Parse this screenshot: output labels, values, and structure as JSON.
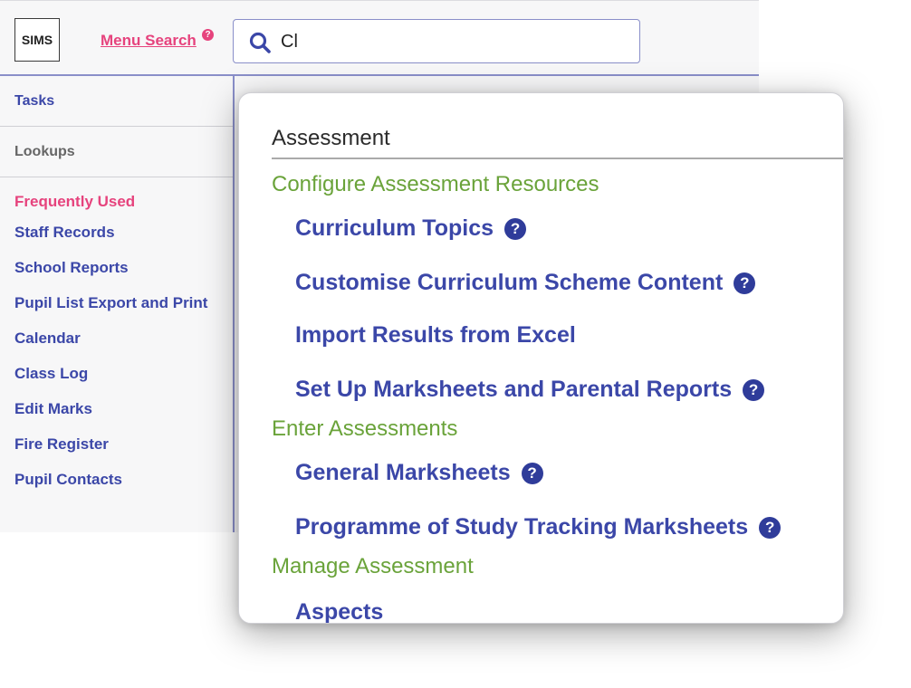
{
  "header": {
    "logo": "SIMS",
    "menu_search_label": "Menu Search",
    "menu_search_help": "?",
    "search_value": "Cl"
  },
  "sidebar": {
    "tabs": [
      {
        "label": "Tasks"
      },
      {
        "label": "Lookups"
      }
    ],
    "heading": "Frequently Used",
    "items": [
      {
        "label": "Staff Records"
      },
      {
        "label": "School Reports"
      },
      {
        "label": "Pupil List Export and Print"
      },
      {
        "label": "Calendar"
      },
      {
        "label": "Class Log"
      },
      {
        "label": "Edit Marks"
      },
      {
        "label": "Fire Register"
      },
      {
        "label": "Pupil Contacts"
      }
    ]
  },
  "popup": {
    "section_title": "Assessment",
    "help_glyph": "?",
    "groups": [
      {
        "label": "Configure Assessment Resources"
      },
      {
        "label": "Enter Assessments"
      },
      {
        "label": "Manage Assessment"
      }
    ],
    "items": [
      {
        "label": "Curriculum Topics"
      },
      {
        "label": "Customise Curriculum Scheme Content"
      },
      {
        "label": "Import Results from Excel"
      },
      {
        "label": "Set Up Marksheets and Parental Reports"
      },
      {
        "label": "General Marksheets"
      },
      {
        "label": "Programme of Study Tracking Marksheets"
      },
      {
        "label": "Aspects"
      }
    ]
  },
  "colors": {
    "primary": "#3b47a8",
    "accent": "#e6437d",
    "group": "#6aa33a",
    "border": "#8a8fc9"
  }
}
